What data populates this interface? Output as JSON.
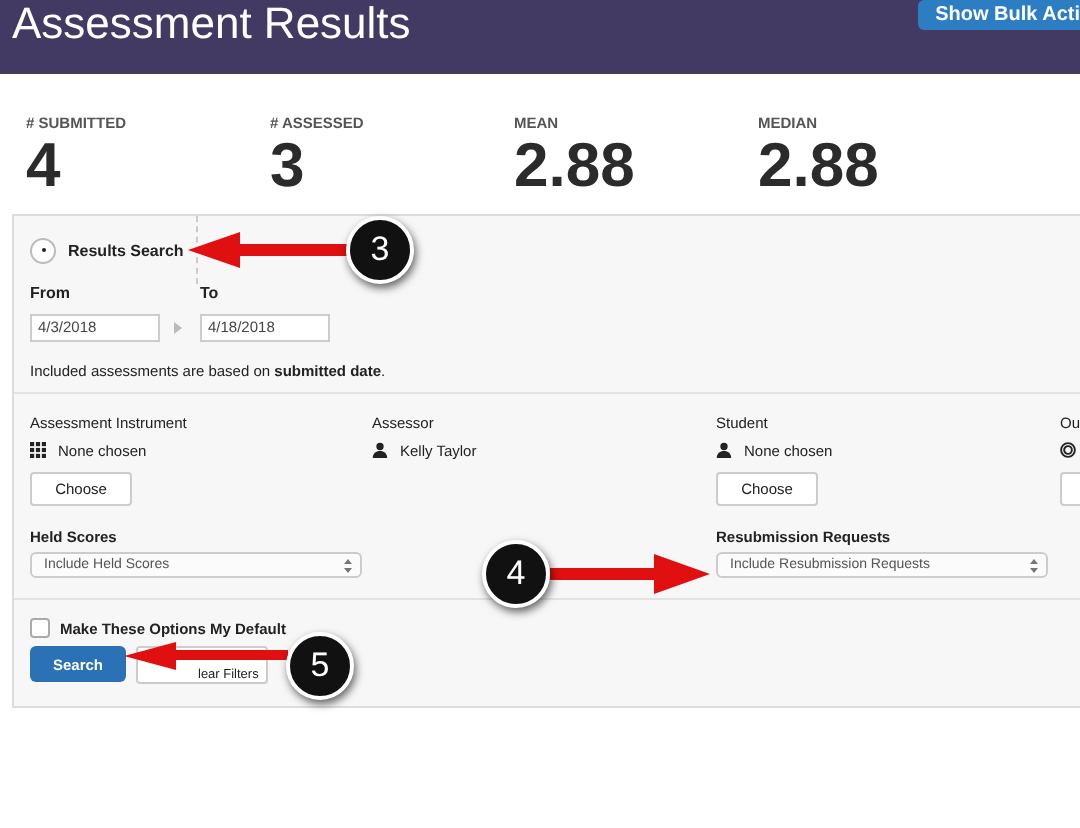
{
  "header": {
    "title": "Assessment Results",
    "bulk_button": "Show Bulk Acti"
  },
  "stats": [
    {
      "label": "# SUBMITTED",
      "value": "4"
    },
    {
      "label": "# ASSESSED",
      "value": "3"
    },
    {
      "label": "MEAN",
      "value": "2.88"
    },
    {
      "label": "MEDIAN",
      "value": "2.88"
    }
  ],
  "search": {
    "title": "Results Search",
    "from_label": "From",
    "from_value": "4/3/2018",
    "to_label": "To",
    "to_value": "4/18/2018",
    "note": "Included assessments are based on **submitted date**."
  },
  "filters": [
    {
      "label": "Assessment Instrument",
      "value": "None chosen",
      "button": "Choose"
    },
    {
      "label": "Assessor",
      "value": "Kelly Taylor"
    },
    {
      "label": "Student",
      "value": "None chosen",
      "button": "Choose"
    },
    {
      "label": "Ou",
      "button_cut": true
    }
  ],
  "selects": [
    {
      "label": "Held Scores",
      "value": "Include Held Scores"
    },
    {
      "label": "Resubmission Requests",
      "value": "Include Resubmission Requests"
    }
  ],
  "default_option": {
    "label": "Make These Options My Default",
    "checked": false
  },
  "buttons": {
    "search": "Search",
    "clear": "lear Filters"
  },
  "callouts": [
    {
      "number": "3"
    },
    {
      "number": "4"
    },
    {
      "number": "5"
    }
  ]
}
